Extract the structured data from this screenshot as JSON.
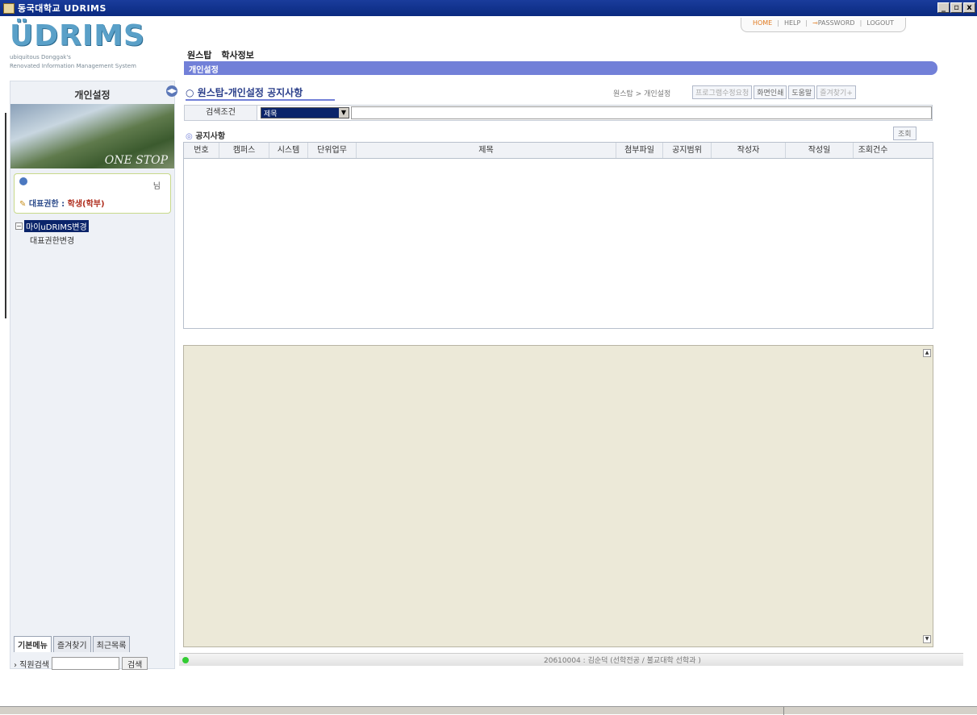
{
  "window": {
    "title": "동국대학교 UDRIMS",
    "btn_min": "_",
    "btn_max": "▫",
    "btn_close": "x"
  },
  "logo": {
    "text": "ÜDRIMS",
    "sub1": "ubiquitous Donggak's",
    "sub2": "Renovated Information Management System"
  },
  "topnav": {
    "home": "HOME",
    "help": "HELP",
    "password": "PASSWORD",
    "logout": "LOGOUT"
  },
  "menu": {
    "item1": "원스탑",
    "item2": "학사정보"
  },
  "bluebar": {
    "label": "개인설정"
  },
  "sidebar": {
    "heading": "개인설정",
    "photo_caption": "ONE STOP",
    "user_suffix": "님",
    "role_label": "대표권한 : ",
    "role_value": "학생(학부)",
    "tree_root": "마이uDRIMS변경",
    "tree_child": "대표권한변경",
    "tabs": [
      "기본메뉴",
      "즐겨찾기",
      "최근목록"
    ],
    "search_label": "› 직원검색",
    "search_button": "검색"
  },
  "main": {
    "title": "○ 원스탑-개인설정 공지사항",
    "breadcrumb": "원스탑 > 개인설정",
    "buttons": {
      "program": "프로그램수정요청",
      "print": "화면인쇄",
      "help": "도움말",
      "fav": "즐겨찾기+"
    },
    "search_condition_label": "검색조건",
    "search_condition_value": "제목",
    "notice_title": "공지사항",
    "view_button": "조회",
    "columns": [
      "번호",
      "캠퍼스",
      "시스템",
      "단위업무",
      "제목",
      "첨부파일",
      "공지범위",
      "작성자",
      "작성일",
      "조회건수"
    ]
  },
  "status": {
    "user": "20610004 : 김순덕 (선학전공 / 불교대학 선학과 )"
  }
}
